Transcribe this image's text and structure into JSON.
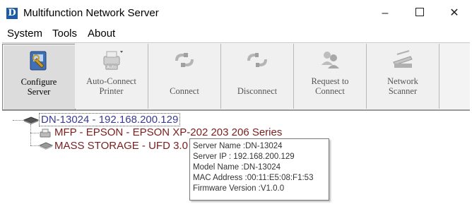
{
  "window": {
    "icon_letter": "D",
    "title": "Multifunction Network Server",
    "minimize_glyph": "–",
    "close_glyph": "✕"
  },
  "menu": [
    "System",
    "Tools",
    "About"
  ],
  "toolbar": [
    {
      "line1": "Configure",
      "line2": "Server",
      "icon": "configure-server-icon",
      "enabled": true
    },
    {
      "line1": "Auto-Connect",
      "line2": "Printer",
      "icon": "auto-connect-printer-icon",
      "enabled": false
    },
    {
      "line1": "",
      "line2": "Connect",
      "icon": "connect-icon",
      "enabled": false
    },
    {
      "line1": "",
      "line2": "Disconnect",
      "icon": "disconnect-icon",
      "enabled": false
    },
    {
      "line1": "Request to",
      "line2": "Connect",
      "icon": "request-to-connect-icon",
      "enabled": false
    },
    {
      "line1": "Network",
      "line2": "Scanner",
      "icon": "network-scanner-icon",
      "enabled": false
    }
  ],
  "tree": {
    "root": "DN-13024 - 192.168.200.129",
    "children": [
      "MFP - EPSON - EPSON XP-202 203 206 Series",
      "MASS STORAGE - UFD 3.0 -"
    ]
  },
  "tooltip": [
    "Server Name :DN-13024",
    "Server IP : 192.168.200.129",
    "Model Name :DN-13024",
    "MAC Address :00:11:E5:08:F1:53",
    "Firmware Version :V1.0.0"
  ],
  "colors": {
    "root_text": "#3b3b8f",
    "child_text": "#7a1e1e",
    "app_icon": "#1d5aa8"
  }
}
